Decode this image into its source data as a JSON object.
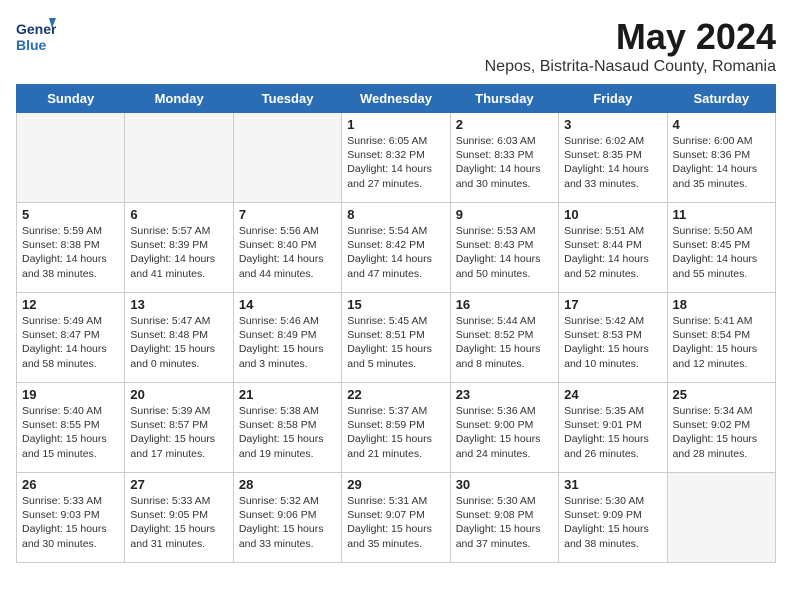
{
  "header": {
    "logo_line1": "General",
    "logo_line2": "Blue",
    "month_year": "May 2024",
    "location": "Nepos, Bistrita-Nasaud County, Romania"
  },
  "weekdays": [
    "Sunday",
    "Monday",
    "Tuesday",
    "Wednesday",
    "Thursday",
    "Friday",
    "Saturday"
  ],
  "weeks": [
    [
      {
        "day": "",
        "info": ""
      },
      {
        "day": "",
        "info": ""
      },
      {
        "day": "",
        "info": ""
      },
      {
        "day": "1",
        "info": "Sunrise: 6:05 AM\nSunset: 8:32 PM\nDaylight: 14 hours\nand 27 minutes."
      },
      {
        "day": "2",
        "info": "Sunrise: 6:03 AM\nSunset: 8:33 PM\nDaylight: 14 hours\nand 30 minutes."
      },
      {
        "day": "3",
        "info": "Sunrise: 6:02 AM\nSunset: 8:35 PM\nDaylight: 14 hours\nand 33 minutes."
      },
      {
        "day": "4",
        "info": "Sunrise: 6:00 AM\nSunset: 8:36 PM\nDaylight: 14 hours\nand 35 minutes."
      }
    ],
    [
      {
        "day": "5",
        "info": "Sunrise: 5:59 AM\nSunset: 8:38 PM\nDaylight: 14 hours\nand 38 minutes."
      },
      {
        "day": "6",
        "info": "Sunrise: 5:57 AM\nSunset: 8:39 PM\nDaylight: 14 hours\nand 41 minutes."
      },
      {
        "day": "7",
        "info": "Sunrise: 5:56 AM\nSunset: 8:40 PM\nDaylight: 14 hours\nand 44 minutes."
      },
      {
        "day": "8",
        "info": "Sunrise: 5:54 AM\nSunset: 8:42 PM\nDaylight: 14 hours\nand 47 minutes."
      },
      {
        "day": "9",
        "info": "Sunrise: 5:53 AM\nSunset: 8:43 PM\nDaylight: 14 hours\nand 50 minutes."
      },
      {
        "day": "10",
        "info": "Sunrise: 5:51 AM\nSunset: 8:44 PM\nDaylight: 14 hours\nand 52 minutes."
      },
      {
        "day": "11",
        "info": "Sunrise: 5:50 AM\nSunset: 8:45 PM\nDaylight: 14 hours\nand 55 minutes."
      }
    ],
    [
      {
        "day": "12",
        "info": "Sunrise: 5:49 AM\nSunset: 8:47 PM\nDaylight: 14 hours\nand 58 minutes."
      },
      {
        "day": "13",
        "info": "Sunrise: 5:47 AM\nSunset: 8:48 PM\nDaylight: 15 hours\nand 0 minutes."
      },
      {
        "day": "14",
        "info": "Sunrise: 5:46 AM\nSunset: 8:49 PM\nDaylight: 15 hours\nand 3 minutes."
      },
      {
        "day": "15",
        "info": "Sunrise: 5:45 AM\nSunset: 8:51 PM\nDaylight: 15 hours\nand 5 minutes."
      },
      {
        "day": "16",
        "info": "Sunrise: 5:44 AM\nSunset: 8:52 PM\nDaylight: 15 hours\nand 8 minutes."
      },
      {
        "day": "17",
        "info": "Sunrise: 5:42 AM\nSunset: 8:53 PM\nDaylight: 15 hours\nand 10 minutes."
      },
      {
        "day": "18",
        "info": "Sunrise: 5:41 AM\nSunset: 8:54 PM\nDaylight: 15 hours\nand 12 minutes."
      }
    ],
    [
      {
        "day": "19",
        "info": "Sunrise: 5:40 AM\nSunset: 8:55 PM\nDaylight: 15 hours\nand 15 minutes."
      },
      {
        "day": "20",
        "info": "Sunrise: 5:39 AM\nSunset: 8:57 PM\nDaylight: 15 hours\nand 17 minutes."
      },
      {
        "day": "21",
        "info": "Sunrise: 5:38 AM\nSunset: 8:58 PM\nDaylight: 15 hours\nand 19 minutes."
      },
      {
        "day": "22",
        "info": "Sunrise: 5:37 AM\nSunset: 8:59 PM\nDaylight: 15 hours\nand 21 minutes."
      },
      {
        "day": "23",
        "info": "Sunrise: 5:36 AM\nSunset: 9:00 PM\nDaylight: 15 hours\nand 24 minutes."
      },
      {
        "day": "24",
        "info": "Sunrise: 5:35 AM\nSunset: 9:01 PM\nDaylight: 15 hours\nand 26 minutes."
      },
      {
        "day": "25",
        "info": "Sunrise: 5:34 AM\nSunset: 9:02 PM\nDaylight: 15 hours\nand 28 minutes."
      }
    ],
    [
      {
        "day": "26",
        "info": "Sunrise: 5:33 AM\nSunset: 9:03 PM\nDaylight: 15 hours\nand 30 minutes."
      },
      {
        "day": "27",
        "info": "Sunrise: 5:33 AM\nSunset: 9:05 PM\nDaylight: 15 hours\nand 31 minutes."
      },
      {
        "day": "28",
        "info": "Sunrise: 5:32 AM\nSunset: 9:06 PM\nDaylight: 15 hours\nand 33 minutes."
      },
      {
        "day": "29",
        "info": "Sunrise: 5:31 AM\nSunset: 9:07 PM\nDaylight: 15 hours\nand 35 minutes."
      },
      {
        "day": "30",
        "info": "Sunrise: 5:30 AM\nSunset: 9:08 PM\nDaylight: 15 hours\nand 37 minutes."
      },
      {
        "day": "31",
        "info": "Sunrise: 5:30 AM\nSunset: 9:09 PM\nDaylight: 15 hours\nand 38 minutes."
      },
      {
        "day": "",
        "info": ""
      }
    ]
  ]
}
